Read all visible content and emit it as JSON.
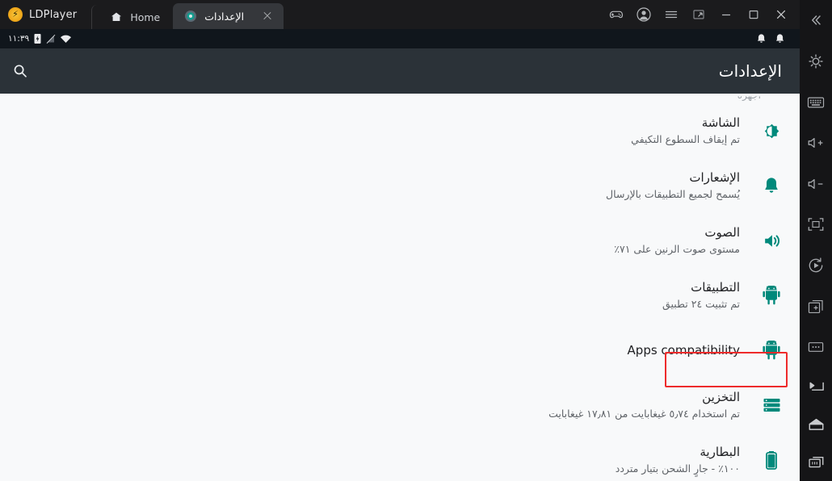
{
  "window": {
    "brand": "LDPlayer",
    "tabs": [
      {
        "label": "Home",
        "icon": "home-icon",
        "active": false
      },
      {
        "label": "الإعدادات",
        "icon": "settings-gear-icon",
        "active": true
      }
    ],
    "controls": [
      {
        "name": "gamepad-icon",
        "label": "Game controls"
      },
      {
        "name": "account-icon",
        "label": "Account"
      },
      {
        "name": "menu-icon",
        "label": "Menu"
      },
      {
        "name": "multi-window-icon",
        "label": "Multi window"
      },
      {
        "name": "minimize-icon",
        "label": "Minimize"
      },
      {
        "name": "maximize-icon",
        "label": "Maximize"
      },
      {
        "name": "close-icon",
        "label": "Close"
      }
    ]
  },
  "statusbar": {
    "time": "١١:٣٩",
    "icons": [
      "battery-charging-icon",
      "signal-off-icon",
      "wifi-icon"
    ],
    "right_icons": [
      "bell-icon",
      "bell-icon"
    ]
  },
  "appheader": {
    "title": "الإعدادات",
    "search_icon": "search-icon"
  },
  "settings": {
    "cut_off_text": "أجهزة",
    "items": [
      {
        "id": "display",
        "title": "الشاشة",
        "subtitle": "تم إيقاف السطوع التكيفي",
        "icon": "brightness-icon",
        "rtl": true,
        "highlighted": false
      },
      {
        "id": "notifications",
        "title": "الإشعارات",
        "subtitle": "يُسمح لجميع التطبيقات بالإرسال",
        "icon": "bell-icon",
        "rtl": true,
        "highlighted": false
      },
      {
        "id": "sound",
        "title": "الصوت",
        "subtitle": "مستوى صوت الرنين على ٧١٪",
        "icon": "volume-icon",
        "rtl": true,
        "highlighted": false
      },
      {
        "id": "apps",
        "title": "التطبيقات",
        "subtitle": "تم تثبيت ٢٤ تطبيق",
        "icon": "android-icon",
        "rtl": true,
        "highlighted": true
      },
      {
        "id": "apps-compatibility",
        "title": "Apps compatibility",
        "subtitle": "",
        "icon": "android-icon",
        "rtl": false,
        "highlighted": false
      },
      {
        "id": "storage",
        "title": "التخزين",
        "subtitle": "تم استخدام ٥٫٧٤ غيغابايت من ١٧٫٨١ غيغابايت",
        "icon": "storage-icon",
        "rtl": true,
        "highlighted": false
      },
      {
        "id": "battery",
        "title": "البطارية",
        "subtitle": "١٠٠٪ - جارٍ الشحن بتيار متردد",
        "icon": "battery-icon",
        "rtl": true,
        "highlighted": false
      }
    ]
  },
  "sidebar": {
    "top_items": [
      {
        "name": "collapse-icon",
        "label": "Collapse"
      },
      {
        "name": "gear-icon",
        "label": "Settings"
      },
      {
        "name": "keyboard-icon",
        "label": "Keyboard"
      },
      {
        "name": "volume-up-icon",
        "label": "Volume up"
      },
      {
        "name": "volume-down-icon",
        "label": "Volume down"
      },
      {
        "name": "fullscreen-icon",
        "label": "Fullscreen"
      },
      {
        "name": "rotate-icon",
        "label": "Rotate"
      },
      {
        "name": "screenshot-icon",
        "label": "Screenshot"
      },
      {
        "name": "more-icon",
        "label": "More"
      }
    ],
    "bottom_items": [
      {
        "name": "back-icon",
        "label": "Back"
      },
      {
        "name": "home-icon",
        "label": "Home"
      },
      {
        "name": "recents-icon",
        "label": "Recent apps"
      }
    ]
  },
  "colors": {
    "accent_teal": "#00897b",
    "highlight_red": "#ee2b2b",
    "header_dark": "#2b3238",
    "titlebar_dark": "#1b1b1d",
    "content_bg": "#f8f9fa"
  }
}
